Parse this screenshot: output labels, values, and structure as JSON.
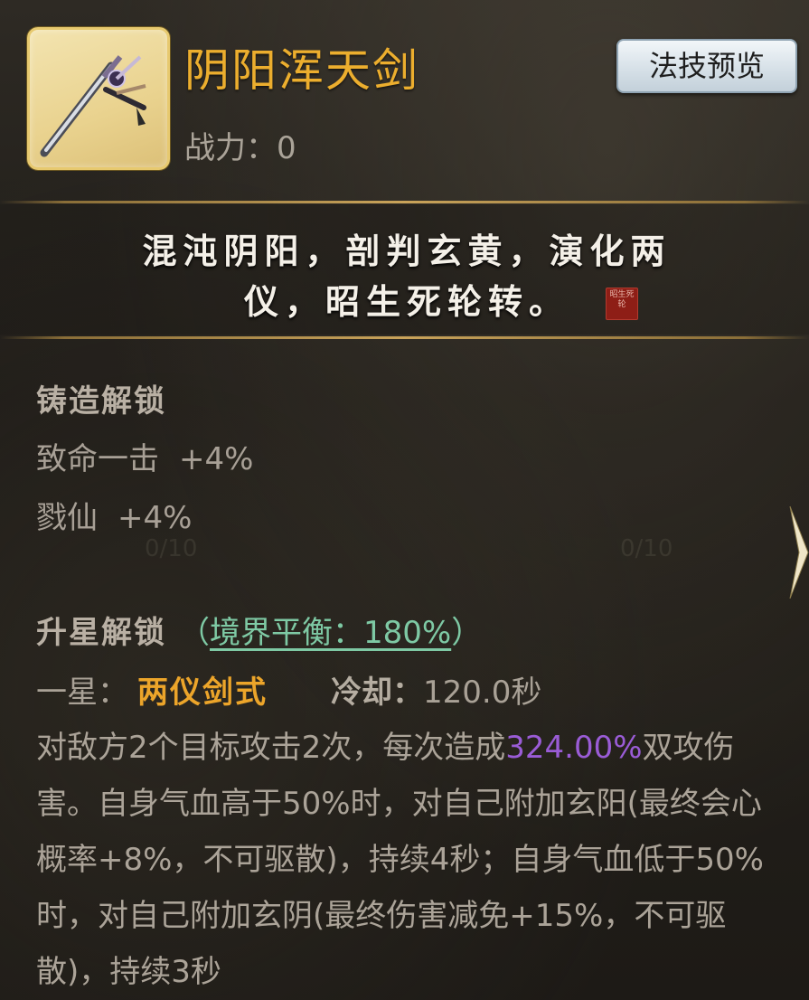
{
  "item": {
    "name": "阴阳浑天剑",
    "power_label": "战力：",
    "power_value": "0",
    "icon": "sword-icon"
  },
  "header": {
    "preview_button": "法技预览"
  },
  "quote": {
    "line1": "混沌阴阳，剖判玄黄，演化两",
    "line2": "仪，昭生死轮转。",
    "seal": "昭生死轮"
  },
  "forge_unlock": {
    "title": "铸造解锁",
    "stats": [
      {
        "name": "致命一击",
        "value": "+4%"
      },
      {
        "name": "戮仙",
        "value": "+4%"
      }
    ]
  },
  "background_counters": [
    "0/10",
    "0/10"
  ],
  "star_unlock": {
    "title": "升星解锁",
    "realm_open": "（",
    "realm_text": "境界平衡：180%",
    "realm_close": "）",
    "star_label": "一星：",
    "skill_name": "两仪剑式",
    "cooldown_label": "冷却：",
    "cooldown_value": "120.0秒",
    "desc_part1": "对敌方2个目标攻击2次，每次造成",
    "desc_highlight": "324.00%",
    "desc_part2": "双攻伤害。自身气血高于50%时，对自己附加玄阳(最终会心概率+8%，不可驱散)，持续4秒；自身气血低于50%时，对自己附加玄阴(最终伤害减免+15%，不可驱散)，持续3秒"
  },
  "colors": {
    "item_name": "#ecae2e",
    "skill_name": "#eca52a",
    "realm": "#7ec9a4",
    "damage_highlight": "#9a5cd6",
    "icon_frame": "#e7c96f"
  }
}
